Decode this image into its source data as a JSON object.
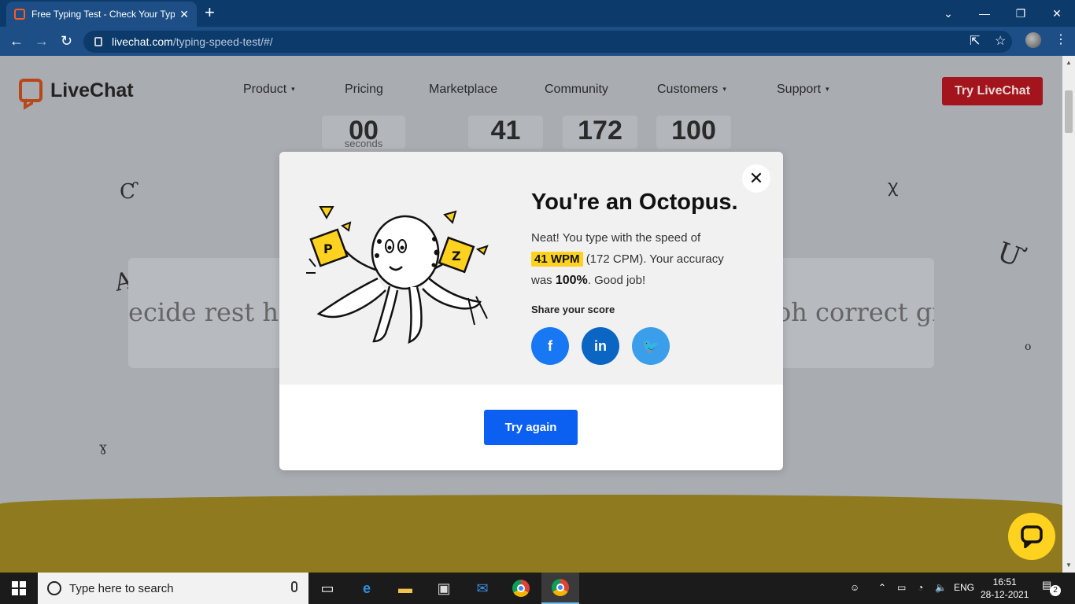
{
  "browser": {
    "tab_title": "Free Typing Test - Check Your Typ",
    "new_tab": "+",
    "url_host": "livechat.com",
    "url_path": "/typing-speed-test/#/"
  },
  "header": {
    "logo_text": "LiveChat",
    "nav": [
      {
        "label": "Product",
        "caret": "▾"
      },
      {
        "label": "Pricing"
      },
      {
        "label": "Marketplace"
      },
      {
        "label": "Community"
      },
      {
        "label": "Customers",
        "caret": "▾"
      },
      {
        "label": "Support",
        "caret": "▾"
      }
    ],
    "cta": "Try LiveChat"
  },
  "stats": {
    "seconds_value": "00",
    "seconds_label": "seconds",
    "wpm_value": "41",
    "cpm_value": "172",
    "accuracy_value": "100"
  },
  "typing_text": {
    "left": "ecide rest he",
    "right": "oh correct gi"
  },
  "modal": {
    "headline": "You're an Octopus.",
    "text_pre": "Neat! You type with the speed of",
    "wpm": "41 WPM",
    "text_mid": "(172 CPM). Your accuracy",
    "text_was": "was",
    "accuracy": "100%",
    "text_post": ". Good job!",
    "share_label": "Share your score",
    "share": [
      {
        "name": "facebook",
        "glyph": "f",
        "color": "#1877f2"
      },
      {
        "name": "linkedin",
        "glyph": "in",
        "color": "#0a66c2"
      },
      {
        "name": "twitter",
        "glyph": "🐦",
        "color": "#3a9eea"
      }
    ],
    "close": "✕",
    "try_again": "Try again",
    "tile_p": "P",
    "tile_z": "Z"
  },
  "taskbar": {
    "search_placeholder": "Type here to search",
    "lang": "ENG",
    "time": "16:51",
    "date": "28-12-2021",
    "notif_count": "2"
  },
  "colors": {
    "accent_red": "#a3141c",
    "highlight": "#ffd21f",
    "primary_button": "#0b60f2"
  }
}
